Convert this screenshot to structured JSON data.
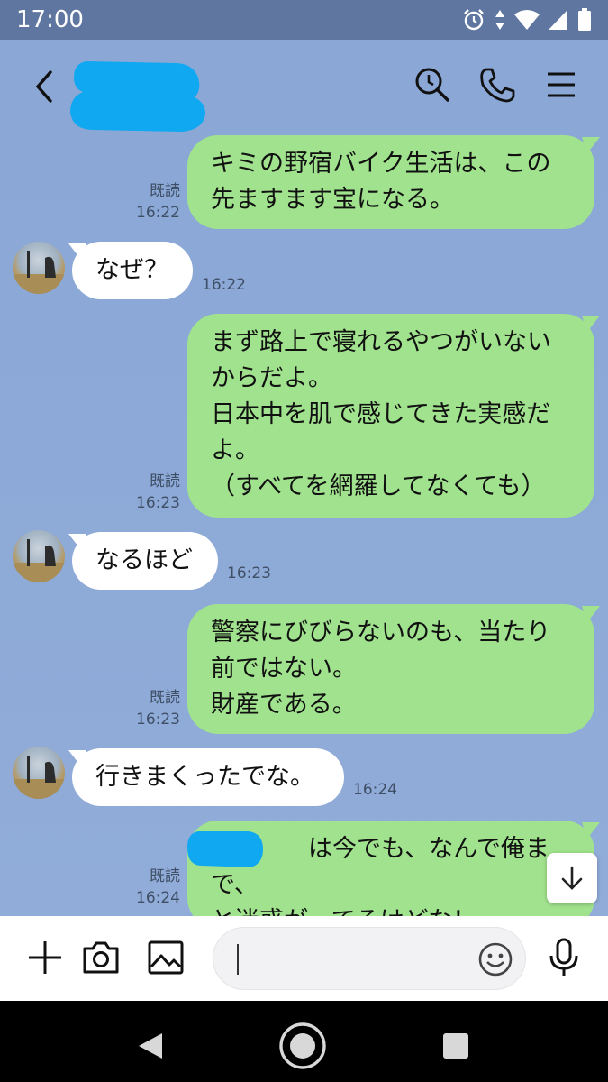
{
  "status_bar": {
    "time": "17:00"
  },
  "header": {
    "back_icon": "chevron-left-icon",
    "search_icon": "search-icon",
    "call_icon": "phone-icon",
    "menu_icon": "menu-icon"
  },
  "messages": [
    {
      "side": "out",
      "read": "既読",
      "time": "16:22",
      "text": "キミの野宿バイク生活は、この\n先ますます宝になる。"
    },
    {
      "side": "in",
      "time": "16:22",
      "text": "なぜ？"
    },
    {
      "side": "out",
      "read": "既読",
      "time": "16:23",
      "text": "まず路上で寝れるやつがいない\nからだよ。\n日本中を肌で感じてきた実感だ\nよ。\n（すべてを網羅してなくても）"
    },
    {
      "side": "in",
      "time": "16:23",
      "text": "なるほど"
    },
    {
      "side": "out",
      "read": "既読",
      "time": "16:23",
      "text": "警察にびびらないのも、当たり\n前ではない。\n財産である。"
    },
    {
      "side": "in",
      "time": "16:24",
      "text": "行きまくったでな。"
    },
    {
      "side": "out",
      "read": "既読",
      "time": "16:24",
      "text": "　　　　は今でも、なんで俺まで、\nと迷惑がってるけどな！"
    }
  ],
  "colors": {
    "chat_bg": "#8aa7d6",
    "status_bar_bg": "#5f76a0",
    "outgoing_bubble": "#a0e28d",
    "incoming_bubble": "#ffffff",
    "redaction": "#10a8f0"
  },
  "input_bar": {
    "plus_icon": "plus-icon",
    "camera_icon": "camera-icon",
    "image_icon": "image-icon",
    "emoji_icon": "emoji-icon",
    "mic_icon": "microphone-icon",
    "message_value": ""
  },
  "nav_bar": {
    "back_icon": "triangle-back-icon",
    "home_icon": "circle-home-icon",
    "recent_icon": "square-recent-icon"
  }
}
